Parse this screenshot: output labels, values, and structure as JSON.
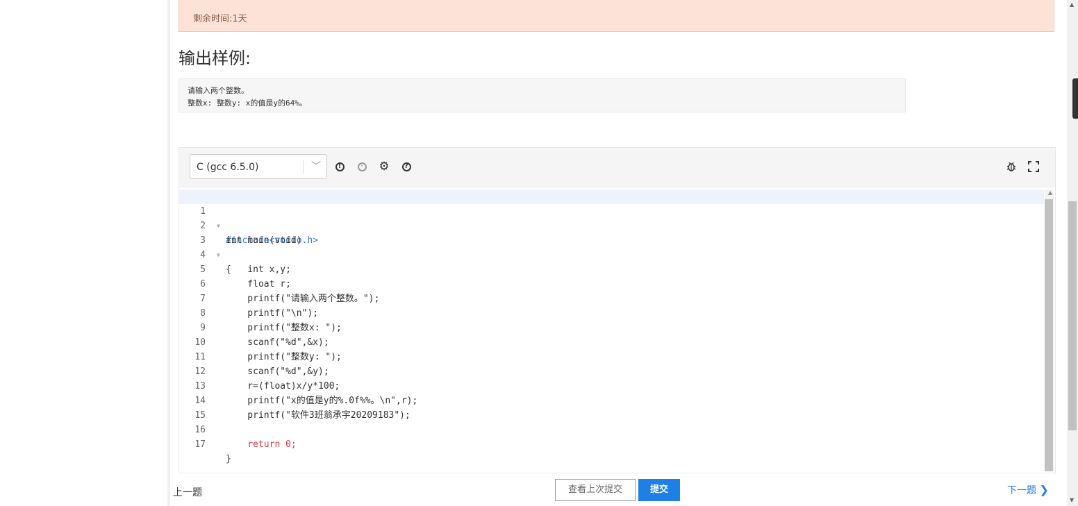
{
  "alert": {
    "text": "剩余时间:1天"
  },
  "section": {
    "title": "输出样例:"
  },
  "sample_output": {
    "lines": [
      "请输入两个整数。",
      "整数x: 整数y: x的值是y的64%。"
    ]
  },
  "editor": {
    "language": "C (gcc 6.5.0)",
    "icons": [
      "info-icon",
      "history-icon",
      "settings-icon",
      "help-icon",
      "debug-icon",
      "fullscreen-icon"
    ],
    "line_numbers": [
      "1",
      "2",
      "3",
      "4",
      "5",
      "6",
      "7",
      "8",
      "9",
      "10",
      "11",
      "12",
      "13",
      "14",
      "15",
      "16",
      "17"
    ],
    "code": [
      "#include<stdio.h>",
      "int main(void)",
      "{",
      "    int x,y;",
      "    float r;",
      "    printf(\"请输入两个整数。\");",
      "    printf(\"\\n\");",
      "    printf(\"整数x: \");",
      "    scanf(\"%d\",&x);",
      "    printf(\"整数y: \");",
      "    scanf(\"%d\",&y);",
      "    r=(float)x/y*100;",
      "    printf(\"x的值是y的%.0f%%。\\n\",r);",
      "    printf(\"软件3班翁承宇20209183\");",
      "    ",
      "    return 0;",
      "}"
    ]
  },
  "footer": {
    "prev_label": "上一题",
    "view_last_label": "查看上次提交",
    "submit_label": "提交",
    "next_label": "下一题"
  },
  "colors": {
    "alert_bg": "#fde3d7",
    "primary": "#1e80e6"
  }
}
